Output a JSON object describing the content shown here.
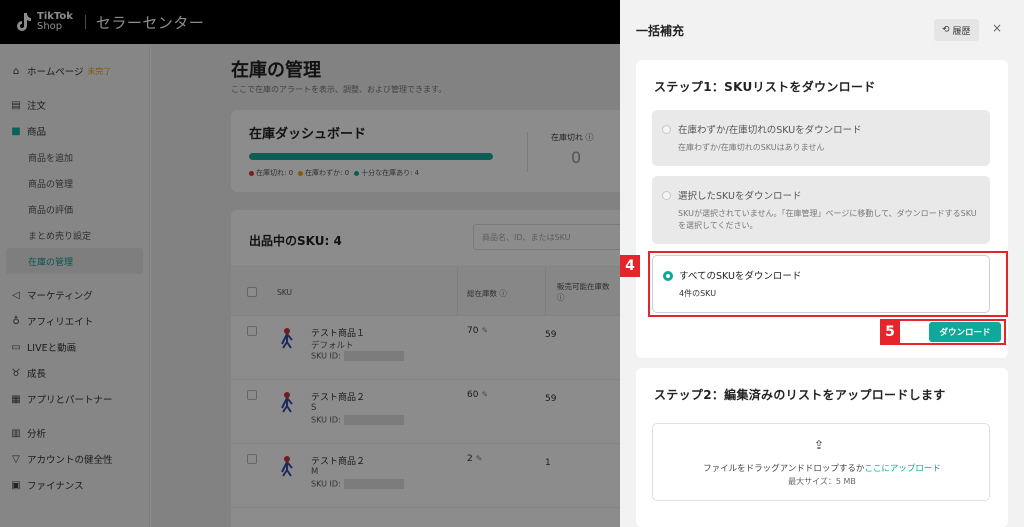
{
  "topbar": {
    "logo_line1": "TikTok",
    "logo_line2": "Shop",
    "title": "セラーセンター"
  },
  "sidebar": {
    "home": {
      "label": "ホームページ",
      "badge": "未完了"
    },
    "orders": "注文",
    "products": "商品",
    "product_subs": [
      "商品を追加",
      "商品の管理",
      "商品の評価",
      "まとめ売り設定",
      "在庫の管理"
    ],
    "marketing": "マーケティング",
    "affiliate": "アフィリエイト",
    "live_video": "LIVEと動画",
    "growth": "成長",
    "apps_partners": "アプリとパートナー",
    "analytics": "分析",
    "account_health": "アカウントの健全性",
    "finance": "ファイナンス"
  },
  "main": {
    "title": "在庫の管理",
    "description": "ここで在庫のアラートを表示、調整、および管理できます。",
    "dashboard": {
      "title": "在庫ダッシュボード",
      "bar_fill_fraction": 1.0,
      "legend": [
        {
          "label": "在庫切れ: 0",
          "color": "#e0343a"
        },
        {
          "label": "在庫わずか: 0",
          "color": "#f2a71b"
        },
        {
          "label": "十分な在庫あり: 4",
          "color": "#17a99b"
        }
      ],
      "stat_label": "在庫切れ ⓘ",
      "stat_value": "0"
    },
    "sku_card": {
      "title": "出品中のSKU: 4",
      "search_placeholder": "商品名、ID、またはSKU",
      "headers": {
        "sku": "SKU",
        "total": "総在庫数 ⓘ",
        "available": "販売可能在庫数 ⓘ"
      },
      "rows": [
        {
          "name": "テスト商品１",
          "variant": "デフォルト",
          "skuid_label": "SKU ID:",
          "total": "70",
          "available": "59"
        },
        {
          "name": "テスト商品２",
          "variant": "S",
          "skuid_label": "SKU ID:",
          "total": "60",
          "available": "59"
        },
        {
          "name": "テスト商品２",
          "variant": "M",
          "skuid_label": "SKU ID:",
          "total": "2",
          "available": "1"
        }
      ]
    }
  },
  "drawer": {
    "title": "一括補充",
    "history_label": "履歴",
    "close_label": "×",
    "step1": {
      "title": "ステップ1：SKUリストをダウンロード",
      "options": [
        {
          "label": "在庫わずか/在庫切れのSKUをダウンロード",
          "desc": "在庫わずか/在庫切れのSKUはありません"
        },
        {
          "label": "選択したSKUをダウンロード",
          "desc": "SKUが選択されていません。「在庫管理」ページに移動して、ダウンロードするSKUを選択してください。"
        },
        {
          "label": "すべてのSKUをダウンロード",
          "desc": "4件のSKU"
        }
      ],
      "download_label": "ダウンロード"
    },
    "step2": {
      "title": "ステップ2：編集済みのリストをアップロードします",
      "upload_text": "ファイルをドラッグアンドドロップするか",
      "upload_link": "ここにアップロード",
      "max_size": "最大サイズ：5 MB"
    }
  },
  "annotations": {
    "badge4": "4",
    "badge5": "5"
  },
  "colors": {
    "accent": "#0fa89b",
    "highlight": "#e5242b"
  }
}
